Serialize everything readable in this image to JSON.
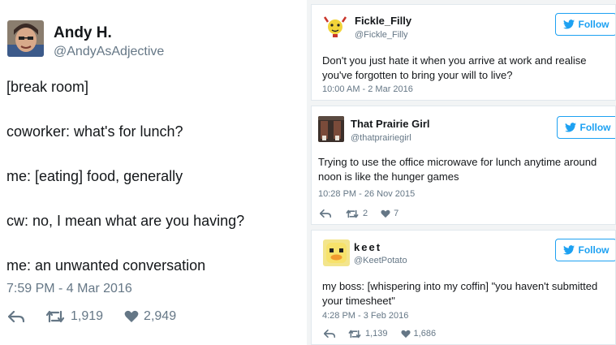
{
  "colors": {
    "brand": "#1da1f2",
    "text": "#14171a",
    "muted": "#657786",
    "border": "#e1e8ed"
  },
  "tweets": [
    {
      "name": "Andy H.",
      "handle": "@AndyAsAdjective",
      "lines": [
        "[break room]",
        "coworker: what's for lunch?",
        "me: [eating] food, generally",
        "cw: no, I mean what are you having?",
        "me: an unwanted conversation"
      ],
      "timestamp": "7:59 PM - 4 Mar 2016",
      "retweets": "1,919",
      "likes": "2,949"
    },
    {
      "name": "Fickle_Filly",
      "handle": "@Fickle_Filly",
      "follow_label": "Follow",
      "text": "Don't you just hate it when you arrive at work and realise you've forgotten to bring your will to live?",
      "timestamp": "10:00 AM - 2 Mar 2016"
    },
    {
      "name": "That Prairie Girl",
      "handle": "@thatprairiegirl",
      "follow_label": "Follow",
      "text": "Trying to use the office microwave for lunch anytime around noon is like the hunger games",
      "timestamp": "10:28 PM - 26 Nov 2015",
      "retweets": "2",
      "likes": "7"
    },
    {
      "name": "keet",
      "handle": "@KeetPotato",
      "follow_label": "Follow",
      "text": "my boss: [whispering into my coffin] \"you haven't submitted your timesheet\"",
      "timestamp": "4:28 PM - 3 Feb 2016",
      "retweets": "1,139",
      "likes": "1,686"
    }
  ]
}
